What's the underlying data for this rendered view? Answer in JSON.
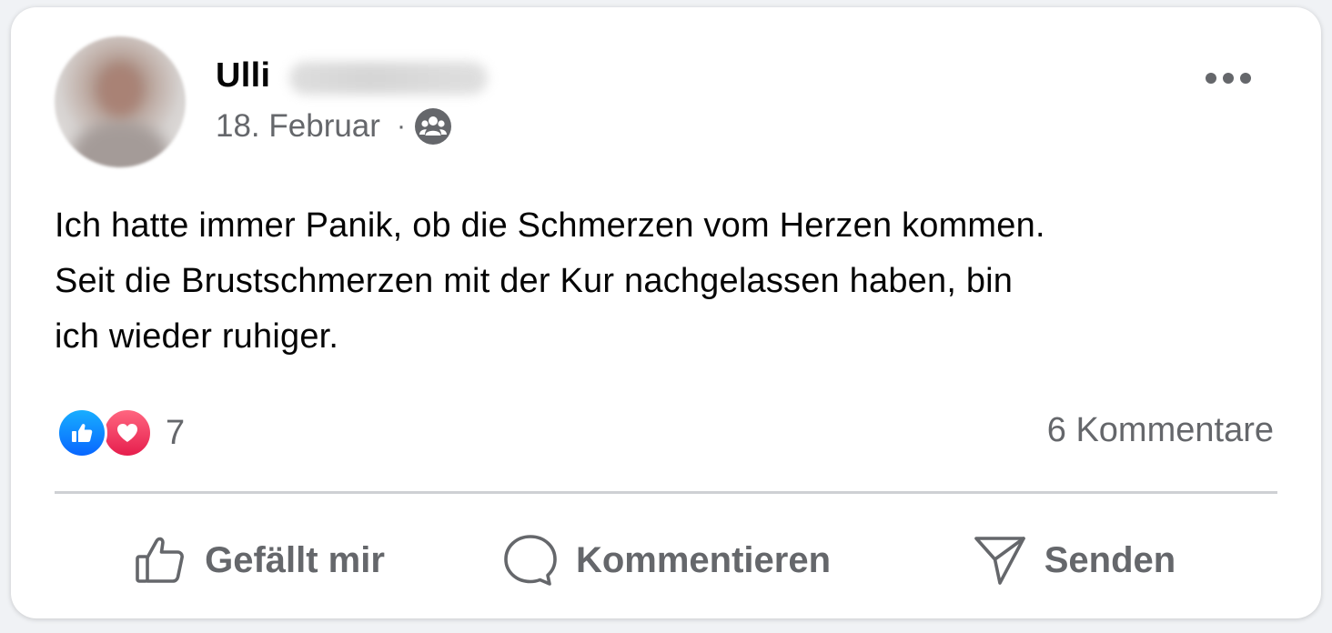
{
  "post": {
    "author_first_name": "Ulli",
    "date": "18. Februar",
    "separator": "·",
    "audience_icon": "group-icon",
    "text": "Ich hatte immer Panik, ob die Schmerzen vom Herzen kommen.\nSeit die Brustschmerzen mit der Kur nachgelassen haben, bin\nich wieder ruhiger.",
    "more_icon": "more-horizontal-icon"
  },
  "stats": {
    "reaction_icons": [
      "like-icon",
      "love-icon"
    ],
    "reaction_count": "7",
    "comments": "6 Kommentare"
  },
  "actions": [
    {
      "label": "Gefällt mir",
      "icon": "thumbs-up-icon"
    },
    {
      "label": "Kommentieren",
      "icon": "comment-bubble-icon"
    },
    {
      "label": "Senden",
      "icon": "send-icon"
    }
  ],
  "colors": {
    "like_blue": "#0866ff",
    "love_red": "#f33e58",
    "secondary_text": "#65676b",
    "primary_text": "#050505"
  }
}
